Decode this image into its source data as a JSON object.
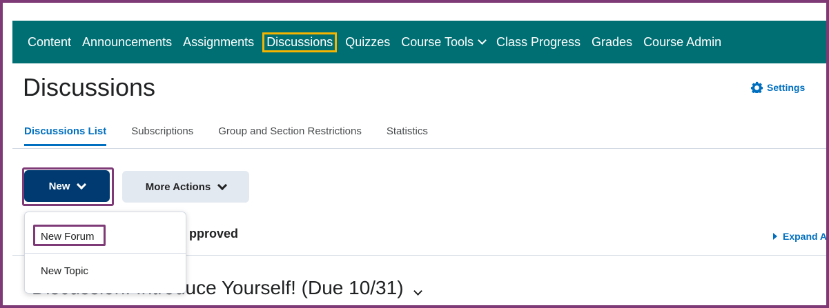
{
  "navigation": [
    {
      "label": "Content"
    },
    {
      "label": "Announcements"
    },
    {
      "label": "Assignments"
    },
    {
      "label": "Discussions",
      "highlighted": true
    },
    {
      "label": "Quizzes"
    },
    {
      "label": "Course Tools",
      "has_dropdown": true
    },
    {
      "label": "Class Progress"
    },
    {
      "label": "Grades"
    },
    {
      "label": "Course Admin"
    }
  ],
  "page": {
    "title": "Discussions"
  },
  "settings": {
    "label": "Settings",
    "icon": "gear-icon"
  },
  "tabs": [
    {
      "label": "Discussions List",
      "active": true
    },
    {
      "label": "Subscriptions"
    },
    {
      "label": "Group and Section Restrictions"
    },
    {
      "label": "Statistics"
    }
  ],
  "actions": {
    "new_label": "New",
    "more_label": "More Actions"
  },
  "dropdown": {
    "items": [
      {
        "label": "New Forum"
      },
      {
        "label": "New Topic"
      }
    ]
  },
  "background": {
    "partial_text": "pproved",
    "expand_label": "Expand A"
  },
  "forum": {
    "title": "Discussion: Introduce Yourself! (Due 10/31)"
  },
  "colors": {
    "nav_bg": "#006f73",
    "highlight_yellow": "#f4b400",
    "highlight_purple": "#7e3a76",
    "primary": "#003a70",
    "link": "#006fbf"
  }
}
